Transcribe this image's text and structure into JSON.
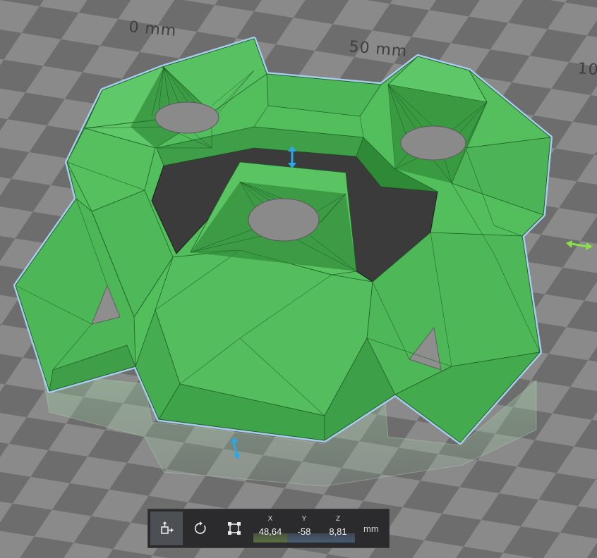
{
  "rulers": [
    "0 mm",
    "50 mm",
    "10"
  ],
  "toolbar": {
    "tools": [
      {
        "name": "move-tool-icon",
        "active": true
      },
      {
        "name": "rotate-tool-icon",
        "active": false
      },
      {
        "name": "scale-tool-icon",
        "active": false
      }
    ],
    "coords": {
      "x": {
        "axis": "X",
        "value": "48,64"
      },
      "y": {
        "axis": "Y",
        "value": "-58"
      },
      "z": {
        "axis": "Z",
        "value": "8,81"
      }
    },
    "unit": "mm"
  },
  "colors": {
    "model": "#52be5c",
    "outline": "#a9cdf0",
    "hole": "#3a3a3a",
    "gizmo_vertical": "#2aa8e8",
    "gizmo_horizontal": "#8be04a"
  }
}
